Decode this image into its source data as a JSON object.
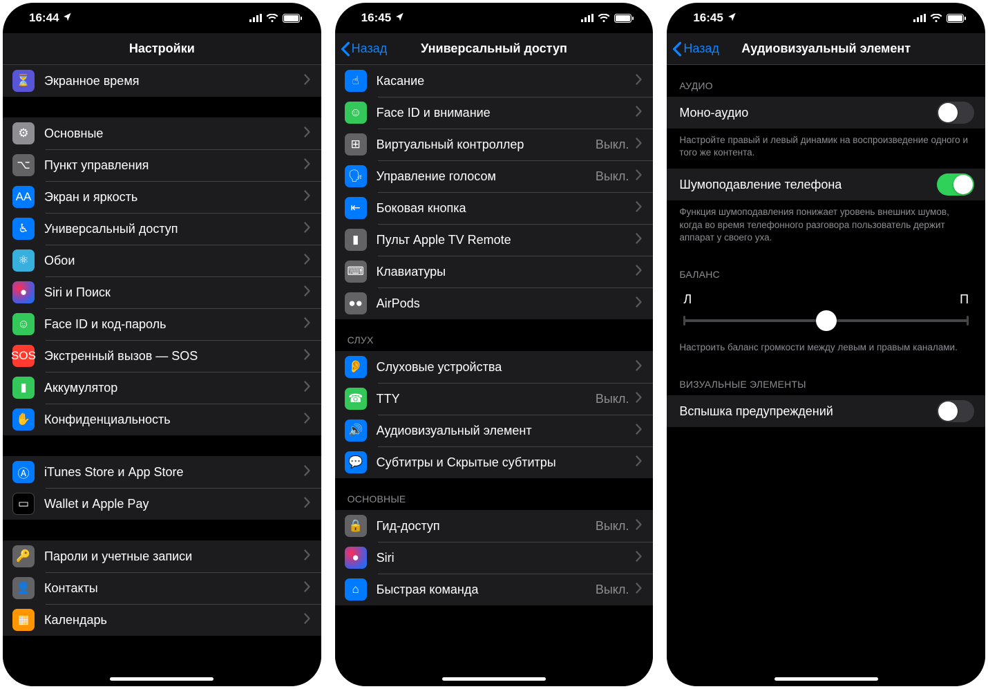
{
  "status": {
    "time1": "16:44",
    "time2": "16:45",
    "time3": "16:45"
  },
  "off_label": "Выкл.",
  "phone1": {
    "title": "Настройки",
    "rows_top": [
      {
        "label": "Экранное время",
        "icon": "hourglass-icon",
        "color": "ic-purple"
      }
    ],
    "rows_main": [
      {
        "label": "Основные",
        "icon": "gear-icon",
        "color": "ic-gray"
      },
      {
        "label": "Пункт управления",
        "icon": "toggles-icon",
        "color": "ic-dgray"
      },
      {
        "label": "Экран и яркость",
        "icon": "aa-icon",
        "color": "ic-blue",
        "text": "AA"
      },
      {
        "label": "Универсальный доступ",
        "icon": "accessibility-icon",
        "color": "ic-blue"
      },
      {
        "label": "Обои",
        "icon": "atom-icon",
        "color": "ic-atom"
      },
      {
        "label": "Siri и Поиск",
        "icon": "siri-icon",
        "color": "ic-siri"
      },
      {
        "label": "Face ID и код-пароль",
        "icon": "faceid-icon",
        "color": "ic-green"
      },
      {
        "label": "Экстренный вызов — SOS",
        "icon": "sos-icon",
        "color": "ic-sos",
        "text": "SOS"
      },
      {
        "label": "Аккумулятор",
        "icon": "battery-icon",
        "color": "ic-green"
      },
      {
        "label": "Конфиденциальность",
        "icon": "hand-icon",
        "color": "ic-hand"
      }
    ],
    "rows_store": [
      {
        "label": "iTunes Store и App Store",
        "icon": "appstore-icon",
        "color": "ic-blue"
      },
      {
        "label": "Wallet и Apple Pay",
        "icon": "wallet-icon",
        "color": "ic-wallet"
      }
    ],
    "rows_accounts": [
      {
        "label": "Пароли и учетные записи",
        "icon": "key-icon",
        "color": "ic-dgray"
      },
      {
        "label": "Контакты",
        "icon": "contacts-icon",
        "color": "ic-dgray"
      },
      {
        "label": "Календарь",
        "icon": "calendar-icon",
        "color": "ic-orange"
      }
    ]
  },
  "phone2": {
    "back": "Назад",
    "title": "Универсальный доступ",
    "rows_motor": [
      {
        "label": "Касание",
        "icon": "touch-icon",
        "color": "ic-blue"
      },
      {
        "label": "Face ID и внимание",
        "icon": "faceid-icon",
        "color": "ic-green"
      },
      {
        "label": "Виртуальный контроллер",
        "icon": "switch-icon",
        "color": "ic-dgray",
        "value_key": "off_label"
      },
      {
        "label": "Управление голосом",
        "icon": "voice-icon",
        "color": "ic-blue",
        "value_key": "off_label"
      },
      {
        "label": "Боковая кнопка",
        "icon": "side-button-icon",
        "color": "ic-blue"
      },
      {
        "label": "Пульт Apple TV Remote",
        "icon": "remote-icon",
        "color": "ic-dgray"
      },
      {
        "label": "Клавиатуры",
        "icon": "keyboard-icon",
        "color": "ic-dgray"
      },
      {
        "label": "AirPods",
        "icon": "airpods-icon",
        "color": "ic-dgray"
      }
    ],
    "section_hearing": "СЛУХ",
    "rows_hearing": [
      {
        "label": "Слуховые устройства",
        "icon": "ear-icon",
        "color": "ic-blue"
      },
      {
        "label": "TTY",
        "icon": "tty-icon",
        "color": "ic-green",
        "value_key": "off_label"
      },
      {
        "label": "Аудиовизуальный элемент",
        "icon": "audiovisual-icon",
        "color": "ic-blue"
      },
      {
        "label": "Субтитры и Скрытые субтитры",
        "icon": "subtitles-icon",
        "color": "ic-blue"
      }
    ],
    "section_general": "ОСНОВНЫЕ",
    "rows_general": [
      {
        "label": "Гид-доступ",
        "icon": "guided-icon",
        "color": "ic-dgray",
        "value_key": "off_label"
      },
      {
        "label": "Siri",
        "icon": "siri-icon",
        "color": "ic-siri"
      },
      {
        "label": "Быстрая команда",
        "icon": "shortcut-icon",
        "color": "ic-blue",
        "value_key": "off_label"
      }
    ]
  },
  "phone3": {
    "back": "Назад",
    "title": "Аудиовизуальный элемент",
    "section_audio": "АУДИО",
    "mono": {
      "label": "Моно-аудио",
      "on": false
    },
    "mono_footer": "Настройте правый и левый динамик на воспроизведение одного и того же контента.",
    "noise": {
      "label": "Шумоподавление телефона",
      "on": true
    },
    "noise_footer": "Функция шумоподавления понижает уровень внешних шумов, когда во время телефонного разговора пользователь держит аппарат у своего уха.",
    "section_balance": "БАЛАНС",
    "balance_left": "Л",
    "balance_right": "П",
    "balance_footer": "Настроить баланс громкости между левым и правым каналами.",
    "section_visual": "ВИЗУАЛЬНЫЕ ЭЛЕМЕНТЫ",
    "flash": {
      "label": "Вспышка предупреждений",
      "on": false
    }
  }
}
